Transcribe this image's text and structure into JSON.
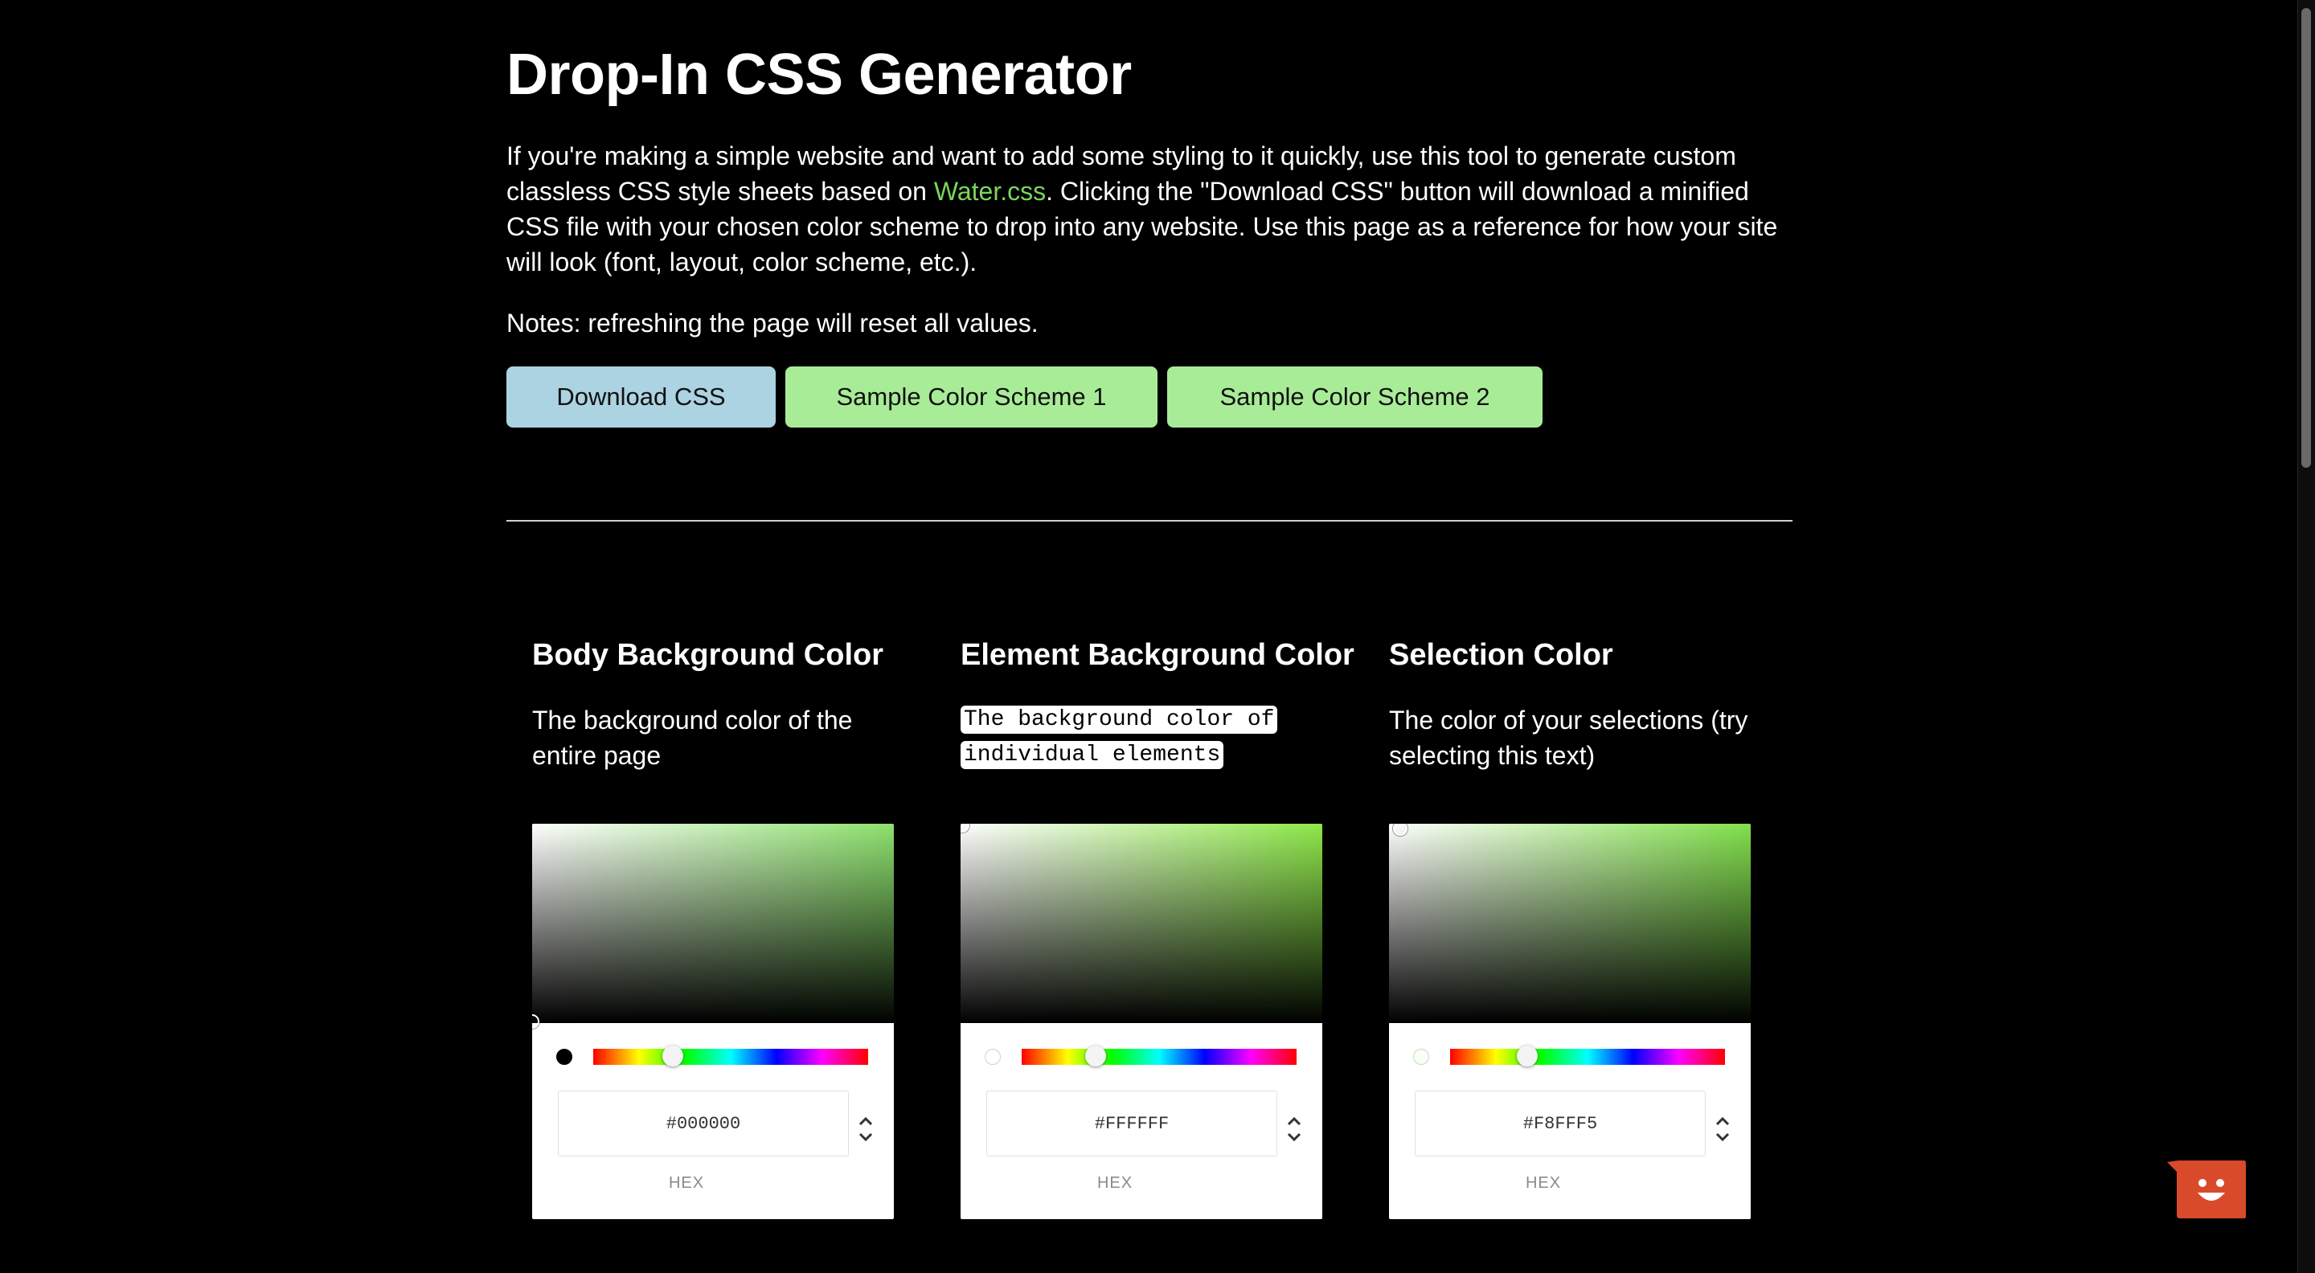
{
  "header": {
    "title": "Drop-In CSS Generator",
    "intro_before_link": "If you're making a simple website and want to add some styling to it quickly, use this tool to generate custom classless CSS style sheets based on ",
    "intro_link": "Water.css",
    "intro_after_link": ". Clicking the \"Download CSS\" button will download a minified CSS file with your chosen color scheme to drop into any website. Use this page as a reference for how your site will look (font, layout, color scheme, etc.).",
    "notes": "Notes: refreshing the page will reset all values."
  },
  "buttons": {
    "download": "Download CSS",
    "scheme1": "Sample Color Scheme 1",
    "scheme2": "Sample Color Scheme 2"
  },
  "pickers": [
    {
      "title": "Body Background Color",
      "description": "The background color of the entire page",
      "hex": "#000000",
      "mode_label": "HEX",
      "hue_color": "#8de26d",
      "hue_fraction": 0.29
    },
    {
      "title": "Element Background Color",
      "description": "The background color of individual elements",
      "hex": "#FFFFFF",
      "mode_label": "HEX",
      "hue_color": "#8ee84a",
      "hue_fraction": 0.27
    },
    {
      "title": "Selection Color",
      "description": "The color of your selections (try selecting this text)",
      "hex": "#F8FFF5",
      "mode_label": "HEX",
      "hue_color": "#82e04c",
      "hue_fraction": 0.28
    }
  ],
  "icons": {
    "stepper": "up-down-chevron-icon",
    "chat": "chat-bot-face-icon"
  },
  "colors": {
    "page_background": "#000000",
    "link": "#7ad65e",
    "download_button": "#abd3e2",
    "scheme_button": "#a8ec98",
    "chat_widget": "#d94a2b"
  }
}
